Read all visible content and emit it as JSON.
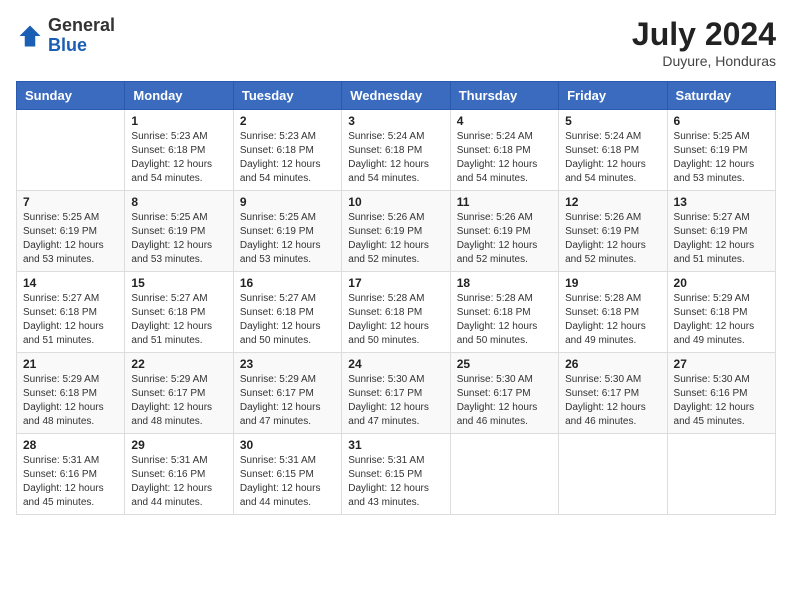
{
  "logo": {
    "general": "General",
    "blue": "Blue"
  },
  "title": "July 2024",
  "location": "Duyure, Honduras",
  "days_of_week": [
    "Sunday",
    "Monday",
    "Tuesday",
    "Wednesday",
    "Thursday",
    "Friday",
    "Saturday"
  ],
  "weeks": [
    [
      {
        "day": "",
        "sunrise": "",
        "sunset": "",
        "daylight": ""
      },
      {
        "day": "1",
        "sunrise": "Sunrise: 5:23 AM",
        "sunset": "Sunset: 6:18 PM",
        "daylight": "Daylight: 12 hours and 54 minutes."
      },
      {
        "day": "2",
        "sunrise": "Sunrise: 5:23 AM",
        "sunset": "Sunset: 6:18 PM",
        "daylight": "Daylight: 12 hours and 54 minutes."
      },
      {
        "day": "3",
        "sunrise": "Sunrise: 5:24 AM",
        "sunset": "Sunset: 6:18 PM",
        "daylight": "Daylight: 12 hours and 54 minutes."
      },
      {
        "day": "4",
        "sunrise": "Sunrise: 5:24 AM",
        "sunset": "Sunset: 6:18 PM",
        "daylight": "Daylight: 12 hours and 54 minutes."
      },
      {
        "day": "5",
        "sunrise": "Sunrise: 5:24 AM",
        "sunset": "Sunset: 6:18 PM",
        "daylight": "Daylight: 12 hours and 54 minutes."
      },
      {
        "day": "6",
        "sunrise": "Sunrise: 5:25 AM",
        "sunset": "Sunset: 6:19 PM",
        "daylight": "Daylight: 12 hours and 53 minutes."
      }
    ],
    [
      {
        "day": "7",
        "sunrise": "Sunrise: 5:25 AM",
        "sunset": "Sunset: 6:19 PM",
        "daylight": "Daylight: 12 hours and 53 minutes."
      },
      {
        "day": "8",
        "sunrise": "Sunrise: 5:25 AM",
        "sunset": "Sunset: 6:19 PM",
        "daylight": "Daylight: 12 hours and 53 minutes."
      },
      {
        "day": "9",
        "sunrise": "Sunrise: 5:25 AM",
        "sunset": "Sunset: 6:19 PM",
        "daylight": "Daylight: 12 hours and 53 minutes."
      },
      {
        "day": "10",
        "sunrise": "Sunrise: 5:26 AM",
        "sunset": "Sunset: 6:19 PM",
        "daylight": "Daylight: 12 hours and 52 minutes."
      },
      {
        "day": "11",
        "sunrise": "Sunrise: 5:26 AM",
        "sunset": "Sunset: 6:19 PM",
        "daylight": "Daylight: 12 hours and 52 minutes."
      },
      {
        "day": "12",
        "sunrise": "Sunrise: 5:26 AM",
        "sunset": "Sunset: 6:19 PM",
        "daylight": "Daylight: 12 hours and 52 minutes."
      },
      {
        "day": "13",
        "sunrise": "Sunrise: 5:27 AM",
        "sunset": "Sunset: 6:19 PM",
        "daylight": "Daylight: 12 hours and 51 minutes."
      }
    ],
    [
      {
        "day": "14",
        "sunrise": "Sunrise: 5:27 AM",
        "sunset": "Sunset: 6:18 PM",
        "daylight": "Daylight: 12 hours and 51 minutes."
      },
      {
        "day": "15",
        "sunrise": "Sunrise: 5:27 AM",
        "sunset": "Sunset: 6:18 PM",
        "daylight": "Daylight: 12 hours and 51 minutes."
      },
      {
        "day": "16",
        "sunrise": "Sunrise: 5:27 AM",
        "sunset": "Sunset: 6:18 PM",
        "daylight": "Daylight: 12 hours and 50 minutes."
      },
      {
        "day": "17",
        "sunrise": "Sunrise: 5:28 AM",
        "sunset": "Sunset: 6:18 PM",
        "daylight": "Daylight: 12 hours and 50 minutes."
      },
      {
        "day": "18",
        "sunrise": "Sunrise: 5:28 AM",
        "sunset": "Sunset: 6:18 PM",
        "daylight": "Daylight: 12 hours and 50 minutes."
      },
      {
        "day": "19",
        "sunrise": "Sunrise: 5:28 AM",
        "sunset": "Sunset: 6:18 PM",
        "daylight": "Daylight: 12 hours and 49 minutes."
      },
      {
        "day": "20",
        "sunrise": "Sunrise: 5:29 AM",
        "sunset": "Sunset: 6:18 PM",
        "daylight": "Daylight: 12 hours and 49 minutes."
      }
    ],
    [
      {
        "day": "21",
        "sunrise": "Sunrise: 5:29 AM",
        "sunset": "Sunset: 6:18 PM",
        "daylight": "Daylight: 12 hours and 48 minutes."
      },
      {
        "day": "22",
        "sunrise": "Sunrise: 5:29 AM",
        "sunset": "Sunset: 6:17 PM",
        "daylight": "Daylight: 12 hours and 48 minutes."
      },
      {
        "day": "23",
        "sunrise": "Sunrise: 5:29 AM",
        "sunset": "Sunset: 6:17 PM",
        "daylight": "Daylight: 12 hours and 47 minutes."
      },
      {
        "day": "24",
        "sunrise": "Sunrise: 5:30 AM",
        "sunset": "Sunset: 6:17 PM",
        "daylight": "Daylight: 12 hours and 47 minutes."
      },
      {
        "day": "25",
        "sunrise": "Sunrise: 5:30 AM",
        "sunset": "Sunset: 6:17 PM",
        "daylight": "Daylight: 12 hours and 46 minutes."
      },
      {
        "day": "26",
        "sunrise": "Sunrise: 5:30 AM",
        "sunset": "Sunset: 6:17 PM",
        "daylight": "Daylight: 12 hours and 46 minutes."
      },
      {
        "day": "27",
        "sunrise": "Sunrise: 5:30 AM",
        "sunset": "Sunset: 6:16 PM",
        "daylight": "Daylight: 12 hours and 45 minutes."
      }
    ],
    [
      {
        "day": "28",
        "sunrise": "Sunrise: 5:31 AM",
        "sunset": "Sunset: 6:16 PM",
        "daylight": "Daylight: 12 hours and 45 minutes."
      },
      {
        "day": "29",
        "sunrise": "Sunrise: 5:31 AM",
        "sunset": "Sunset: 6:16 PM",
        "daylight": "Daylight: 12 hours and 44 minutes."
      },
      {
        "day": "30",
        "sunrise": "Sunrise: 5:31 AM",
        "sunset": "Sunset: 6:15 PM",
        "daylight": "Daylight: 12 hours and 44 minutes."
      },
      {
        "day": "31",
        "sunrise": "Sunrise: 5:31 AM",
        "sunset": "Sunset: 6:15 PM",
        "daylight": "Daylight: 12 hours and 43 minutes."
      },
      {
        "day": "",
        "sunrise": "",
        "sunset": "",
        "daylight": ""
      },
      {
        "day": "",
        "sunrise": "",
        "sunset": "",
        "daylight": ""
      },
      {
        "day": "",
        "sunrise": "",
        "sunset": "",
        "daylight": ""
      }
    ]
  ]
}
